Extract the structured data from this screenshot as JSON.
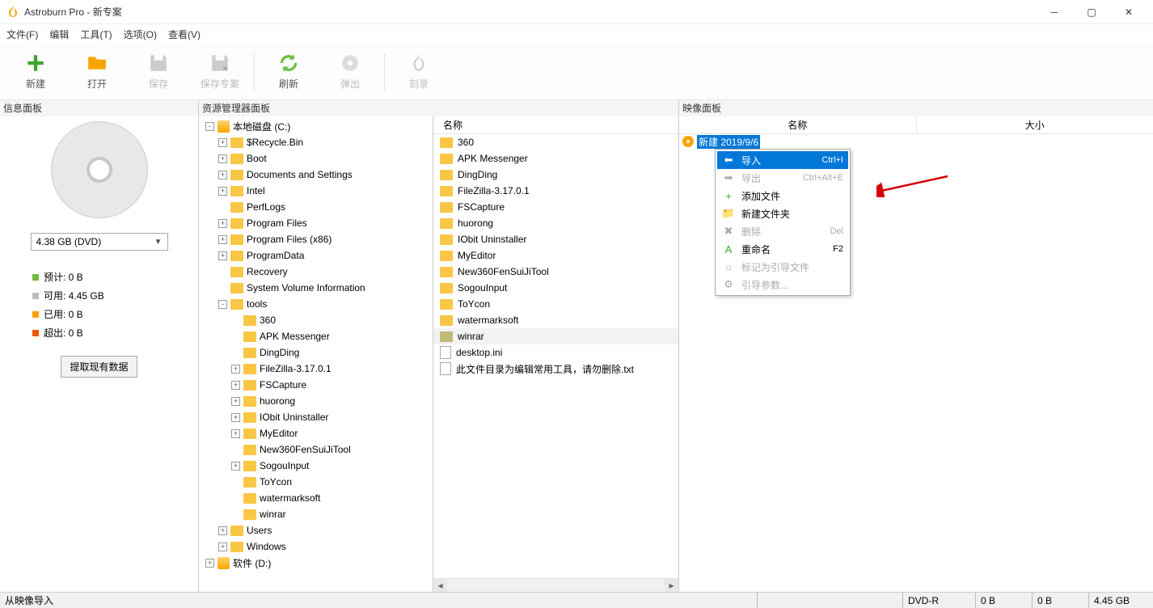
{
  "title": "Astroburn Pro - 新专案",
  "menubar": [
    "文件(F)",
    "编辑",
    "工具(T)",
    "选项(O)",
    "查看(V)"
  ],
  "toolbar": {
    "new": "新建",
    "open": "打开",
    "save": "保存",
    "saveproj": "保存专案",
    "refresh": "刷新",
    "eject": "弹出",
    "burn": "刻录"
  },
  "panels": {
    "info": "信息面板",
    "explorer": "资源管理器面板",
    "image": "映像面板"
  },
  "info": {
    "size_select": "4.38 GB (DVD)",
    "legend": [
      {
        "color": "#6fbf3f",
        "label": "预计:",
        "val": "0 B"
      },
      {
        "color": "#bdbdbd",
        "label": "可用:",
        "val": "4.45 GB"
      },
      {
        "color": "#f4a000",
        "label": "已用:",
        "val": "0 B"
      },
      {
        "color": "#e95a00",
        "label": "超出:",
        "val": "0 B"
      }
    ],
    "extract": "提取现有数据"
  },
  "tree": [
    {
      "d": 0,
      "exp": "-",
      "icon": "disk",
      "label": "本地磁盘 (C:)"
    },
    {
      "d": 1,
      "exp": "+",
      "icon": "fld",
      "label": "$Recycle.Bin"
    },
    {
      "d": 1,
      "exp": "+",
      "icon": "fld",
      "label": "Boot"
    },
    {
      "d": 1,
      "exp": "+",
      "icon": "fld",
      "label": "Documents and Settings"
    },
    {
      "d": 1,
      "exp": "+",
      "icon": "fld",
      "label": "Intel"
    },
    {
      "d": 1,
      "exp": " ",
      "icon": "fld",
      "label": "PerfLogs"
    },
    {
      "d": 1,
      "exp": "+",
      "icon": "fld",
      "label": "Program Files"
    },
    {
      "d": 1,
      "exp": "+",
      "icon": "fld",
      "label": "Program Files (x86)"
    },
    {
      "d": 1,
      "exp": "+",
      "icon": "fld",
      "label": "ProgramData"
    },
    {
      "d": 1,
      "exp": " ",
      "icon": "fld",
      "label": "Recovery"
    },
    {
      "d": 1,
      "exp": " ",
      "icon": "fld",
      "label": "System Volume Information"
    },
    {
      "d": 1,
      "exp": "-",
      "icon": "fld",
      "label": "tools"
    },
    {
      "d": 2,
      "exp": " ",
      "icon": "fld",
      "label": "360"
    },
    {
      "d": 2,
      "exp": " ",
      "icon": "fld",
      "label": "APK Messenger"
    },
    {
      "d": 2,
      "exp": " ",
      "icon": "fld",
      "label": "DingDing"
    },
    {
      "d": 2,
      "exp": "+",
      "icon": "fld",
      "label": "FileZilla-3.17.0.1"
    },
    {
      "d": 2,
      "exp": "+",
      "icon": "fld",
      "label": "FSCapture"
    },
    {
      "d": 2,
      "exp": "+",
      "icon": "fld",
      "label": "huorong"
    },
    {
      "d": 2,
      "exp": "+",
      "icon": "fld",
      "label": "IObit Uninstaller"
    },
    {
      "d": 2,
      "exp": "+",
      "icon": "fld",
      "label": "MyEditor"
    },
    {
      "d": 2,
      "exp": " ",
      "icon": "fld",
      "label": "New360FenSuiJiTool"
    },
    {
      "d": 2,
      "exp": "+",
      "icon": "fld",
      "label": "SogouInput"
    },
    {
      "d": 2,
      "exp": " ",
      "icon": "fld",
      "label": "ToYcon"
    },
    {
      "d": 2,
      "exp": " ",
      "icon": "fld",
      "label": "watermarksoft"
    },
    {
      "d": 2,
      "exp": " ",
      "icon": "fld",
      "label": "winrar"
    },
    {
      "d": 1,
      "exp": "+",
      "icon": "fld",
      "label": "Users"
    },
    {
      "d": 1,
      "exp": "+",
      "icon": "fld",
      "label": "Windows"
    },
    {
      "d": 0,
      "exp": "+",
      "icon": "disk",
      "label": "软件 (D:)"
    }
  ],
  "filelist": {
    "header": "名称",
    "rows": [
      {
        "t": "fld",
        "n": "360"
      },
      {
        "t": "fld",
        "n": "APK Messenger"
      },
      {
        "t": "fld",
        "n": "DingDing"
      },
      {
        "t": "fld",
        "n": "FileZilla-3.17.0.1"
      },
      {
        "t": "fld",
        "n": "FSCapture"
      },
      {
        "t": "fld",
        "n": "huorong"
      },
      {
        "t": "fld",
        "n": "IObit Uninstaller"
      },
      {
        "t": "fld",
        "n": "MyEditor"
      },
      {
        "t": "fld",
        "n": "New360FenSuiJiTool"
      },
      {
        "t": "fld",
        "n": "SogouInput"
      },
      {
        "t": "fld",
        "n": "ToYcon"
      },
      {
        "t": "fld",
        "n": "watermarksoft"
      },
      {
        "t": "fld",
        "n": "winrar",
        "sel": true
      },
      {
        "t": "file",
        "n": "desktop.ini"
      },
      {
        "t": "file",
        "n": "此文件目录为编辑常用工具，请勿删除.txt"
      }
    ]
  },
  "image": {
    "col_name": "名称",
    "col_size": "大小",
    "root": "新建 2019/9/6",
    "menu": [
      {
        "ic": "⬅",
        "txt": "导入",
        "sc": "Ctrl+I",
        "hl": true
      },
      {
        "ic": "➡",
        "txt": "导出",
        "sc": "Ctrl+Alt+E",
        "dis": true
      },
      {
        "ic": "+",
        "txt": "添加文件",
        "color": "#3fa52e"
      },
      {
        "ic": "📁",
        "txt": "新建文件夹",
        "color": "#f7a400"
      },
      {
        "ic": "✖",
        "txt": "删除",
        "sc": "Del",
        "dis": true
      },
      {
        "ic": "A",
        "txt": "重命名",
        "sc": "F2",
        "color": "#3fa52e"
      },
      {
        "ic": "○",
        "txt": "标记为引导文件",
        "dis": true
      },
      {
        "ic": "⚙",
        "txt": "引导参数...",
        "dis": true
      }
    ]
  },
  "status": {
    "msg": "从映像导入",
    "cells": [
      "DVD-R",
      "0 B",
      "0 B",
      "4.45 GB"
    ]
  }
}
